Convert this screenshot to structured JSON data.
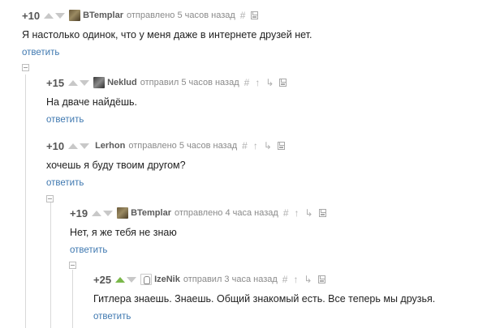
{
  "comments": [
    {
      "rating": "+10",
      "author": "BTemplar",
      "meta": "отправлено 5 часов назад",
      "body": "Я настолько одинок, что у меня даже в интернете друзей нет.",
      "reply": "ответить",
      "avatar_icon": "avatar-photo-icon",
      "tools": [
        "#"
      ]
    },
    {
      "rating": "+15",
      "author": "Neklud",
      "meta": "отправил 5 часов назад",
      "body": "На дваче найдёшь.",
      "reply": "ответить",
      "avatar_icon": "avatar-photo-icon",
      "tools": [
        "#",
        "↑",
        "↳"
      ]
    },
    {
      "rating": "+10",
      "author": "Lerhon",
      "meta": "отправлено 5 часов назад",
      "body": "хочешь я буду твоим другом?",
      "reply": "ответить",
      "tools": [
        "#",
        "↑",
        "↳"
      ]
    },
    {
      "rating": "+19",
      "author": "BTemplar",
      "meta": "отправлено 4 часа назад",
      "body": "Нет, я же тебя не знаю",
      "reply": "ответить",
      "avatar_icon": "avatar-photo-icon",
      "tools": [
        "#",
        "↑",
        "↳"
      ]
    },
    {
      "rating": "+25",
      "author": "IzeNik",
      "meta": "отправил 3 часа назад",
      "body": "Гитлера знаешь. Знаешь. Общий знакомый есть. Все теперь мы друзья.",
      "reply": "ответить",
      "avatar_icon": "avatar-sketch-icon",
      "upvoted": true,
      "tools": [
        "#",
        "↑",
        "↳"
      ]
    }
  ],
  "colors": {
    "link": "#3f78b0",
    "upvote_active": "#7ab84a",
    "muted": "#8a8a8a"
  }
}
